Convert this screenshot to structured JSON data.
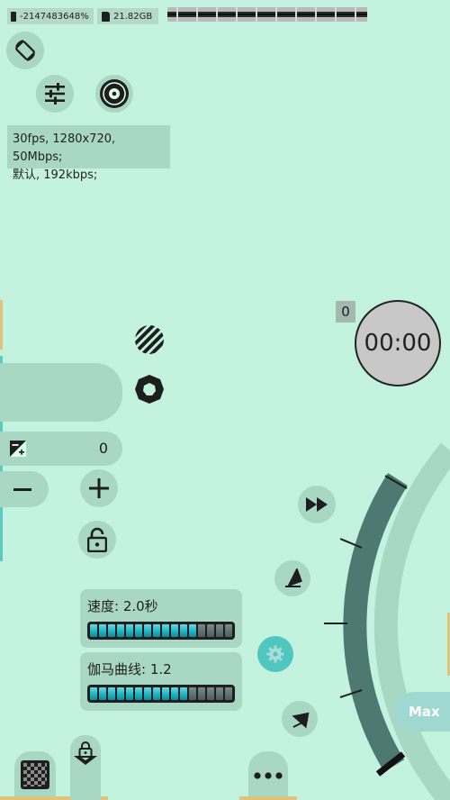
{
  "status": {
    "battery_text": "-2147483648%",
    "storage_text": "21.82GB"
  },
  "info": {
    "line1": "30fps, 1280x720, 50Mbps;",
    "line2": "默认, 192kbps;"
  },
  "exposure": {
    "value": "0"
  },
  "timer": {
    "count_badge": "0",
    "time": "00:00"
  },
  "sliders": {
    "speed_label": "速度: 2.0秒",
    "gamma_label": "伽马曲线: 1.2"
  },
  "zoom": {
    "max_label": "Max"
  },
  "colors": {
    "background": "#c3f3df",
    "panel": "#a8d7c3",
    "accent_teal": "#4fc7c0",
    "arc": "#4e7872",
    "orange_edge": "#e0c27a"
  }
}
